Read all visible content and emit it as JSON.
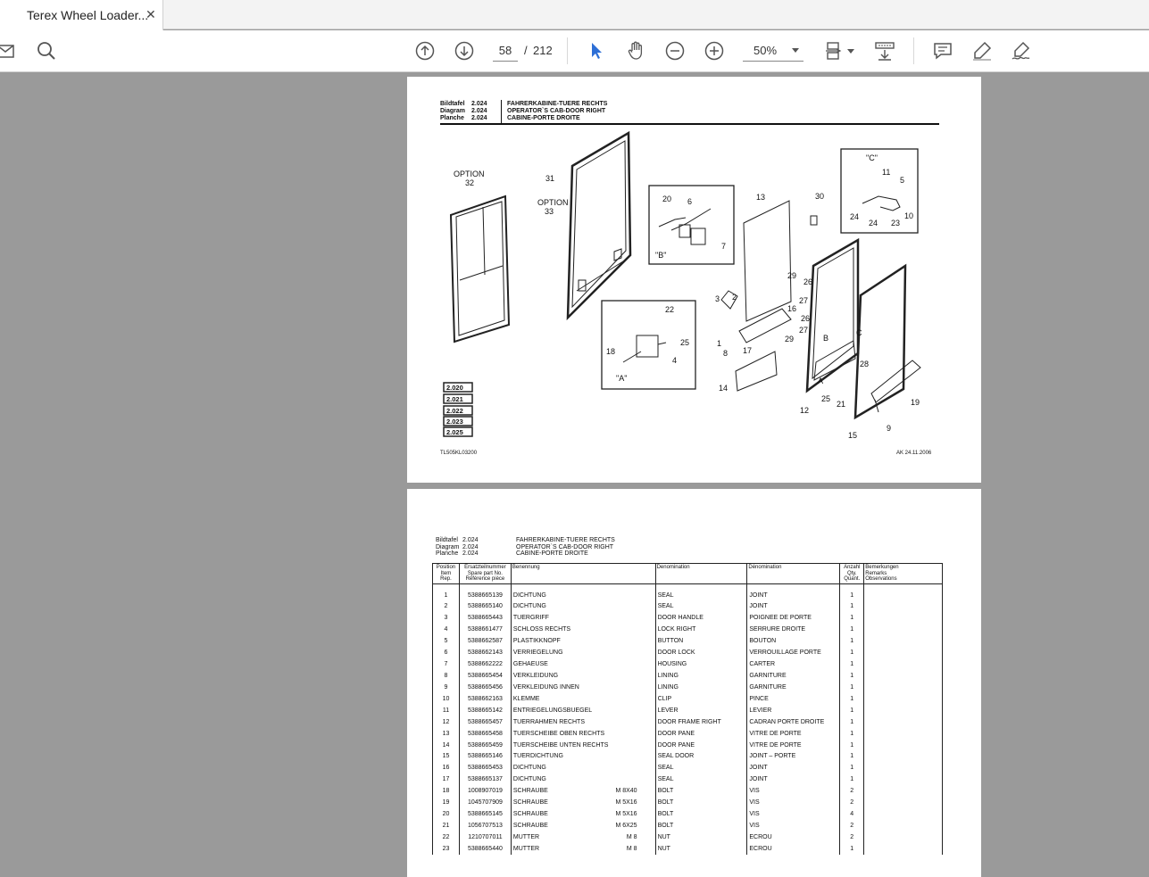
{
  "tab": {
    "title": "Terex Wheel Loader...",
    "close": "✕"
  },
  "toolbar": {
    "page_current": "58",
    "page_separator": "/",
    "page_total": "212",
    "zoom": "50%",
    "icons": [
      "mail-icon",
      "search-icon",
      "page-up-icon",
      "page-down-icon",
      "select-cursor-icon",
      "hand-icon",
      "zoom-out-icon",
      "zoom-in-icon",
      "fit-page-icon",
      "scroll-mode-icon",
      "comment-icon",
      "highlight-icon",
      "sign-icon"
    ]
  },
  "page1": {
    "header": {
      "rows": [
        {
          "label": "Bildtafel",
          "num": "2.024",
          "title": "FAHRERKABINE-TUERE RECHTS"
        },
        {
          "label": "Diagram",
          "num": "2.024",
          "title": "OPERATOR`S CAB-DOOR RIGHT"
        },
        {
          "label": "Planche",
          "num": "2.024",
          "title": "CABINE-PORTE DROITE"
        }
      ]
    },
    "diagram": {
      "option1": "OPTION",
      "option1_num": "32",
      "option2": "OPTION",
      "option2_num": "33",
      "detail_a": "\"A\"",
      "detail_b": "\"B\"",
      "detail_c": "\"C\"",
      "callouts": [
        "31",
        "20",
        "6",
        "7",
        "13",
        "30",
        "11",
        "5",
        "24",
        "24",
        "23",
        "10",
        "3",
        "2",
        "1",
        "8",
        "17",
        "29",
        "26",
        "27",
        "16",
        "26",
        "27",
        "29",
        "22",
        "18",
        "25",
        "4",
        "14",
        "12",
        "25",
        "21",
        "28",
        "9",
        "19",
        "15",
        "B",
        "C",
        "A"
      ],
      "refs": [
        "2.020",
        "2.021",
        "2.022",
        "2.023",
        "2.025"
      ],
      "drawing_id": "TL505KL03200",
      "date": "AK  24.11.2006"
    }
  },
  "page2": {
    "header": {
      "rows": [
        {
          "label": "Bildtafel",
          "num": "2.024",
          "title": "FAHRERKABINE-TUERE RECHTS"
        },
        {
          "label": "Diagram",
          "num": "2.024",
          "title": "OPERATOR`S CAB-DOOR RIGHT"
        },
        {
          "label": "Planche",
          "num": "2.024",
          "title": "CABINE-PORTE DROITE"
        }
      ]
    },
    "columns": {
      "pos": [
        "Position",
        "Item",
        "Rep."
      ],
      "part": [
        "Ersatzteilnummer",
        "Spare part No.",
        "Référence pièce"
      ],
      "benennung": "Benennung",
      "denomination_en": "Denomination",
      "denomination_fr": "Dénomination",
      "qty": [
        "Anzahl",
        "Qty.",
        "Quant."
      ],
      "remarks": [
        "Bemerkungen",
        "Remarks",
        "Observations"
      ]
    },
    "rows": [
      {
        "pos": "1",
        "part": "5388665139",
        "de": "DICHTUNG",
        "dim": "",
        "en": "SEAL",
        "fr": "JOINT",
        "qty": "1"
      },
      {
        "pos": "2",
        "part": "5388665140",
        "de": "DICHTUNG",
        "dim": "",
        "en": "SEAL",
        "fr": "JOINT",
        "qty": "1"
      },
      {
        "pos": "3",
        "part": "5388665443",
        "de": "TUERGRIFF",
        "dim": "",
        "en": "DOOR HANDLE",
        "fr": "POIGNEE DE PORTE",
        "qty": "1"
      },
      {
        "pos": "4",
        "part": "5388661477",
        "de": "SCHLOSS RECHTS",
        "dim": "",
        "en": "LOCK RIGHT",
        "fr": "SERRURE DROITE",
        "qty": "1"
      },
      {
        "pos": "5",
        "part": "5388662587",
        "de": "PLASTIKKNOPF",
        "dim": "",
        "en": "BUTTON",
        "fr": "BOUTON",
        "qty": "1"
      },
      {
        "pos": "6",
        "part": "5388662143",
        "de": "VERRIEGELUNG",
        "dim": "",
        "en": "DOOR LOCK",
        "fr": "VERROUILLAGE PORTE",
        "qty": "1"
      },
      {
        "pos": "7",
        "part": "5388662222",
        "de": "GEHAEUSE",
        "dim": "",
        "en": "HOUSING",
        "fr": "CARTER",
        "qty": "1"
      },
      {
        "pos": "8",
        "part": "5388665454",
        "de": "VERKLEIDUNG",
        "dim": "",
        "en": "LINING",
        "fr": "GARNITURE",
        "qty": "1"
      },
      {
        "pos": "9",
        "part": "5388665456",
        "de": "VERKLEIDUNG INNEN",
        "dim": "",
        "en": "LINING",
        "fr": "GARNITURE",
        "qty": "1"
      },
      {
        "pos": "10",
        "part": "5388662163",
        "de": "KLEMME",
        "dim": "",
        "en": "CLIP",
        "fr": "PINCE",
        "qty": "1"
      },
      {
        "pos": "11",
        "part": "5388665142",
        "de": "ENTRIEGELUNGSBUEGEL",
        "dim": "",
        "en": "LEVER",
        "fr": "LEVIER",
        "qty": "1"
      },
      {
        "pos": "12",
        "part": "5388665457",
        "de": "TUERRAHMEN RECHTS",
        "dim": "",
        "en": "DOOR FRAME RIGHT",
        "fr": "CADRAN PORTE DROITE",
        "qty": "1"
      },
      {
        "pos": "13",
        "part": "5388665458",
        "de": "TUERSCHEIBE OBEN RECHTS",
        "dim": "",
        "en": "DOOR PANE",
        "fr": "VITRE DE PORTE",
        "qty": "1"
      },
      {
        "pos": "14",
        "part": "5388665459",
        "de": "TUERSCHEIBE UNTEN RECHTS",
        "dim": "",
        "en": "DOOR PANE",
        "fr": "VITRE DE PORTE",
        "qty": "1"
      },
      {
        "pos": "15",
        "part": "5388665146",
        "de": "TUERDICHTUNG",
        "dim": "",
        "en": "SEAL DOOR",
        "fr": "JOINT – PORTE",
        "qty": "1"
      },
      {
        "pos": "16",
        "part": "5388665453",
        "de": "DICHTUNG",
        "dim": "",
        "en": "SEAL",
        "fr": "JOINT",
        "qty": "1"
      },
      {
        "pos": "17",
        "part": "5388665137",
        "de": "DICHTUNG",
        "dim": "",
        "en": "SEAL",
        "fr": "JOINT",
        "qty": "1"
      },
      {
        "pos": "18",
        "part": "1008907019",
        "de": "SCHRAUBE",
        "dim": "M 8X40",
        "en": "BOLT",
        "fr": "VIS",
        "qty": "2"
      },
      {
        "pos": "19",
        "part": "1045707909",
        "de": "SCHRAUBE",
        "dim": "M 5X16",
        "en": "BOLT",
        "fr": "VIS",
        "qty": "2"
      },
      {
        "pos": "20",
        "part": "5388665145",
        "de": "SCHRAUBE",
        "dim": "M 5X16",
        "en": "BOLT",
        "fr": "VIS",
        "qty": "4"
      },
      {
        "pos": "21",
        "part": "1056707513",
        "de": "SCHRAUBE",
        "dim": "M 6X25",
        "en": "BOLT",
        "fr": "VIS",
        "qty": "2"
      },
      {
        "pos": "22",
        "part": "1210707011",
        "de": "MUTTER",
        "dim": "M 8",
        "en": "NUT",
        "fr": "ECROU",
        "qty": "2"
      },
      {
        "pos": "23",
        "part": "5388665440",
        "de": "MUTTER",
        "dim": "M 8",
        "en": "NUT",
        "fr": "ECROU",
        "qty": "1"
      }
    ]
  }
}
